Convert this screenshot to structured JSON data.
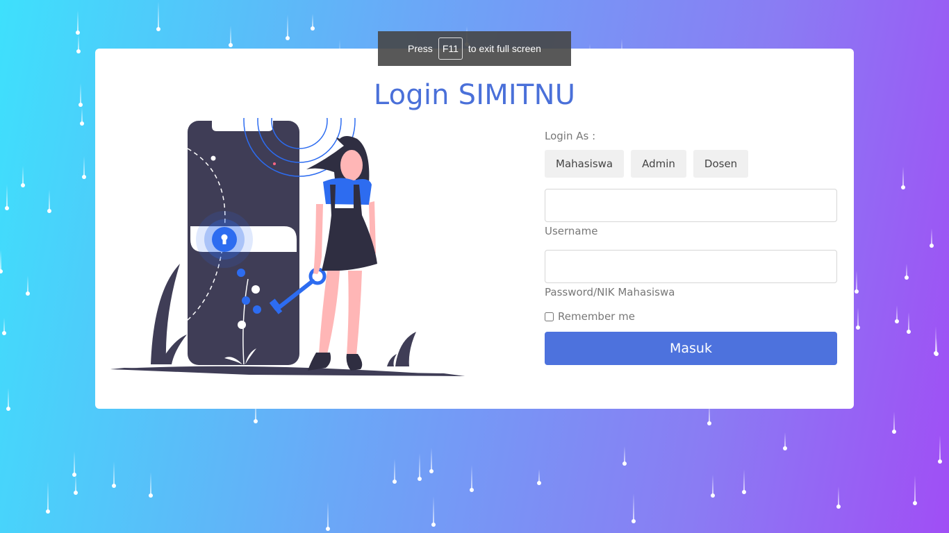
{
  "page": {
    "title": "Login SIMITNU"
  },
  "fullscreen_toast": {
    "prefix": "Press",
    "key": "F11",
    "suffix": "to exit full screen"
  },
  "login_form": {
    "login_as_label": "Login As :",
    "roles": [
      "Mahasiswa",
      "Admin",
      "Dosen"
    ],
    "username": {
      "label": "Username",
      "value": ""
    },
    "password": {
      "label": "Password/NIK Mahasiswa",
      "value": ""
    },
    "remember_label": "Remember me",
    "remember_checked": false,
    "submit_label": "Masuk"
  },
  "illustration": {
    "icons": [
      "phone-icon",
      "lock-icon",
      "key-icon",
      "person-icon",
      "plant-icon"
    ]
  },
  "colors": {
    "accent": "#4d72dd",
    "title": "#4a70d9",
    "background_start": "#3ee0fc",
    "background_end": "#a04ef5",
    "illustration_dark": "#3f3d56",
    "illustration_blue": "#2d6cf0",
    "skin": "#ffb6b6"
  }
}
